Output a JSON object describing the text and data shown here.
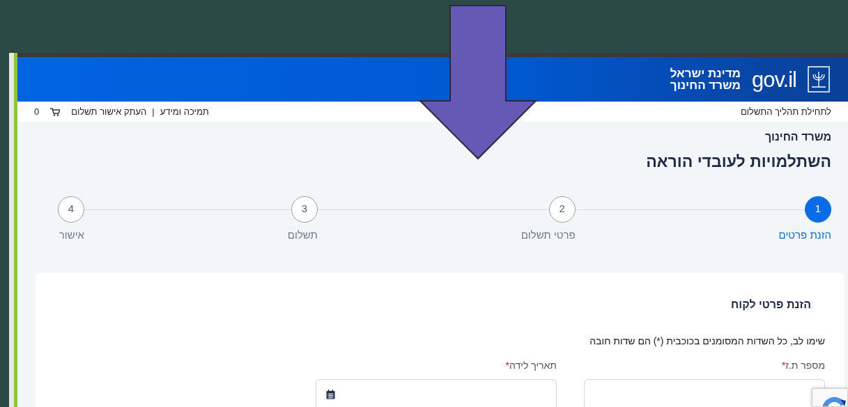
{
  "header": {
    "logo_text": "gov.il",
    "title_lines": [
      "מדינת ישראל",
      "משרד החינוך"
    ]
  },
  "topbar": {
    "start_link": "לתחילת תהליך התשלום",
    "links": [
      "תמיכה ומידע",
      "העתק אישור תשלום"
    ],
    "separator": "|",
    "cart_count": "0"
  },
  "page": {
    "subtitle": "משרד החינוך",
    "title": "השתלמויות לעובדי הוראה"
  },
  "steps": [
    {
      "number": "1",
      "label": "הזנת פרטים",
      "selected": true
    },
    {
      "number": "2",
      "label": "פרטי תשלום",
      "selected": false
    },
    {
      "number": "3",
      "label": "תשלום",
      "selected": false
    },
    {
      "number": "4",
      "label": "אישור",
      "selected": false
    }
  ],
  "form": {
    "heading": "הזנת פרטי לקוח",
    "note": "שימו לב, כל השדות המסומנים בכוכבית (*) הם שדות חובה",
    "fields": [
      {
        "label": "מספר ת.ז",
        "required_mark": "*",
        "kind": "text"
      },
      {
        "label": "תאריך לידה",
        "required_mark": "*",
        "kind": "date"
      }
    ]
  }
}
